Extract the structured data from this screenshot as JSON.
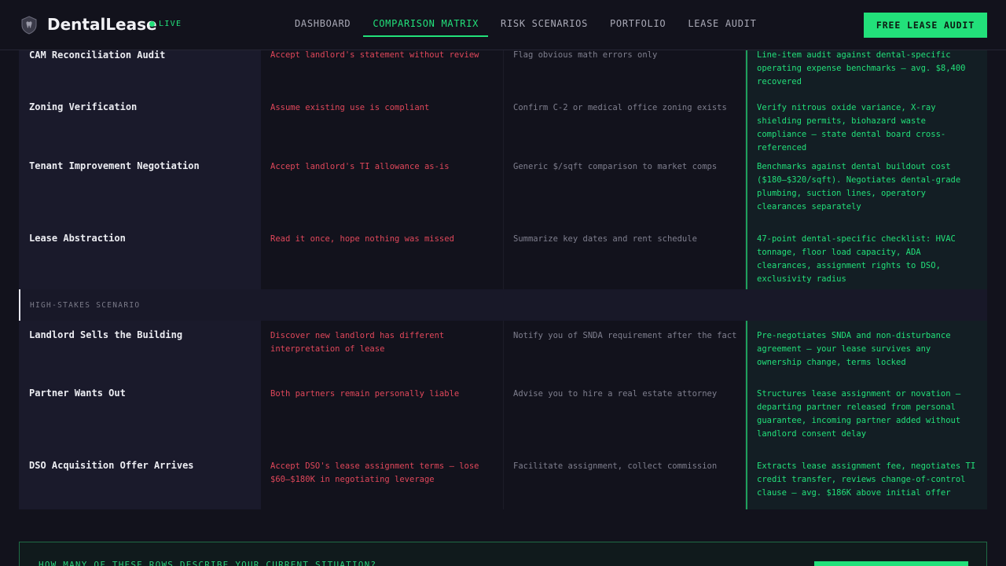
{
  "header": {
    "brand": "DentalLease",
    "live_label": "LIVE",
    "nav": [
      "DASHBOARD",
      "COMPARISON MATRIX",
      "RISK SCENARIOS",
      "PORTFOLIO",
      "LEASE AUDIT"
    ],
    "active_nav": "COMPARISON MATRIX",
    "cta_label": "FREE LEASE AUDIT"
  },
  "colors": {
    "accent": "#22e07a",
    "risk": "#e0475a",
    "muted": "#7f7f8e",
    "background": "#12121c"
  },
  "rows": [
    {
      "label": "CAM Reconciliation Audit",
      "diy": "Accept landlord's statement without review",
      "broker": "Flag obvious math errors only",
      "dentallease": "Line-item audit against dental-specific operating expense benchmarks — avg. $8,400 recovered"
    },
    {
      "label": "Zoning Verification",
      "diy": "Assume existing use is compliant",
      "broker": "Confirm C-2 or medical office zoning exists",
      "dentallease": "Verify nitrous oxide variance, X-ray shielding permits, biohazard waste compliance — state dental board cross-referenced"
    },
    {
      "label": "Tenant Improvement Negotiation",
      "diy": "Accept landlord's TI allowance as-is",
      "broker": "Generic $/sqft comparison to market comps",
      "dentallease": "Benchmarks against dental buildout cost ($180–$320/sqft). Negotiates dental-grade plumbing, suction lines, operatory clearances separately"
    },
    {
      "label": "Lease Abstraction",
      "diy": "Read it once, hope nothing was missed",
      "broker": "Summarize key dates and rent schedule",
      "dentallease": "47-point dental-specific checklist: HVAC tonnage, floor load capacity, ADA clearances, assignment rights to DSO, exclusivity radius"
    }
  ],
  "section_label": "HIGH-STAKES SCENARIO",
  "scenario_rows": [
    {
      "label": "Landlord Sells the Building",
      "diy": "Discover new landlord has different interpretation of lease",
      "broker": "Notify you of SNDA requirement after the fact",
      "dentallease": "Pre-negotiates SNDA and non-disturbance agreement — your lease survives any ownership change, terms locked"
    },
    {
      "label": "Partner Wants Out",
      "diy": "Both partners remain personally liable",
      "broker": "Advise you to hire a real estate attorney",
      "dentallease": "Structures lease assignment or novation — departing partner released from personal guarantee, incoming partner added without landlord consent delay"
    },
    {
      "label": "DSO Acquisition Offer Arrives",
      "diy": "Accept DSO's lease assignment terms — lose $60–$180K in negotiating leverage",
      "broker": "Facilitate assignment, collect commission",
      "dentallease": "Extracts lease assignment fee, negotiates TI credit transfer, reviews change-of-control clause — avg. $186K above initial offer"
    }
  ],
  "cta": {
    "question": "HOW MANY OF THESE ROWS DESCRIBE YOUR CURRENT SITUATION?"
  }
}
